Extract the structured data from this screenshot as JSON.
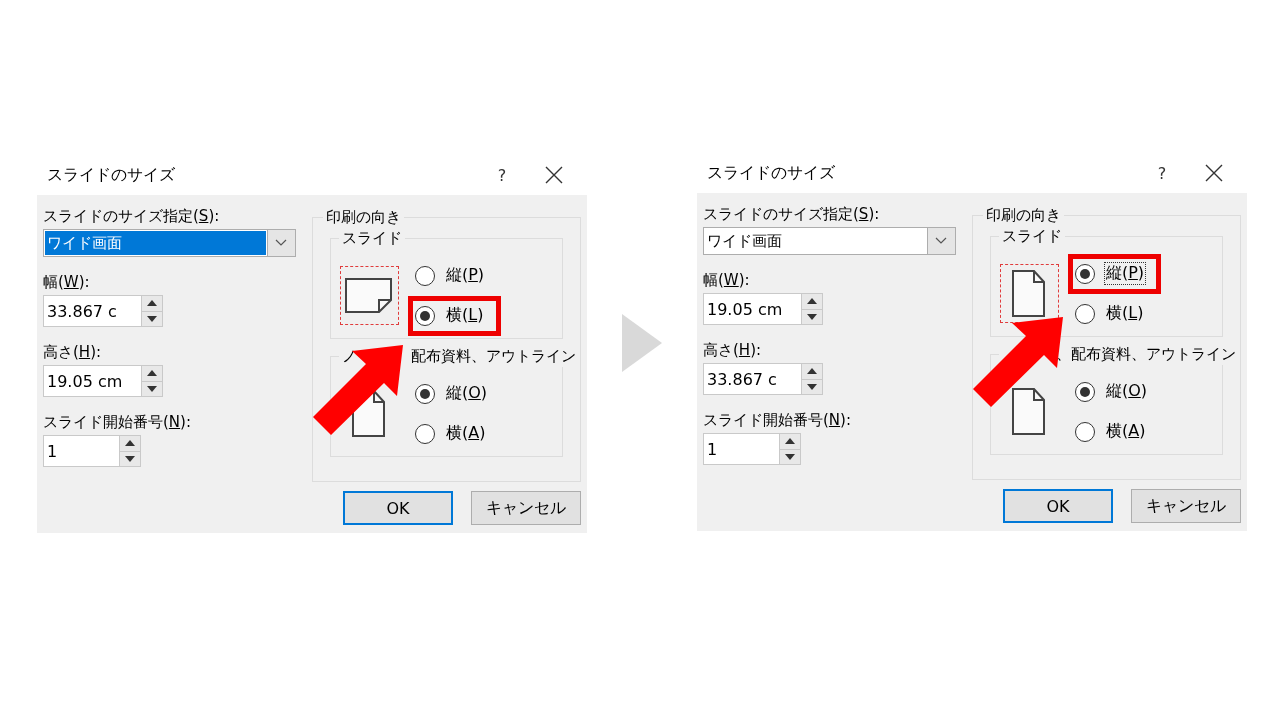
{
  "dialogs": [
    {
      "title": "スライドのサイズ",
      "help": "?",
      "size_label": [
        "スライドのサイズ指定(",
        "S",
        "):"
      ],
      "size_value": "ワイド画面",
      "size_value_highlighted": true,
      "width_label": [
        "幅(",
        "W",
        "):"
      ],
      "width_value": "33.867 c",
      "height_label": [
        "高さ(",
        "H",
        "):"
      ],
      "height_value": "19.05 cm",
      "start_label": [
        "スライド開始番号(",
        "N",
        "):"
      ],
      "start_value": "1",
      "orientation_title": "印刷の向き",
      "slide_group": {
        "label_parts": [
          {
            "kind": "text",
            "text": "スライド"
          }
        ],
        "landscape": true,
        "options": [
          {
            "label": [
              "縦(",
              "P",
              ")"
            ],
            "selected": false,
            "focused": false,
            "highlighted": false
          },
          {
            "label": [
              "横(",
              "L",
              ")"
            ],
            "selected": true,
            "focused": false,
            "highlighted": true
          }
        ]
      },
      "notes_group": {
        "label_parts": [
          {
            "kind": "text",
            "text": "ノ"
          },
          {
            "kind": "covered"
          },
          {
            "kind": "text",
            "text": "配布資料、アウトライン"
          }
        ],
        "landscape": false,
        "options": [
          {
            "label": [
              "縦(",
              "O",
              ")"
            ],
            "selected": true,
            "focused": false,
            "highlighted": false
          },
          {
            "label": [
              "横(",
              "A",
              ")"
            ],
            "selected": false,
            "focused": false,
            "highlighted": false
          }
        ]
      },
      "buttons": [
        {
          "label": "OK",
          "default": true
        },
        {
          "label": "キャンセル",
          "default": false
        }
      ]
    },
    {
      "title": "スライドのサイズ",
      "help": "?",
      "size_label": [
        "スライドのサイズ指定(",
        "S",
        "):"
      ],
      "size_value": "ワイド画面",
      "size_value_highlighted": false,
      "width_label": [
        "幅(",
        "W",
        "):"
      ],
      "width_value": "19.05 cm",
      "height_label": [
        "高さ(",
        "H",
        "):"
      ],
      "height_value": "33.867 c",
      "start_label": [
        "スライド開始番号(",
        "N",
        "):"
      ],
      "start_value": "1",
      "orientation_title": "印刷の向き",
      "slide_group": {
        "label_parts": [
          {
            "kind": "text",
            "text": "スライド"
          }
        ],
        "landscape": false,
        "options": [
          {
            "label": [
              "縦(",
              "P",
              ")"
            ],
            "selected": true,
            "focused": true,
            "highlighted": true
          },
          {
            "label": [
              "横(",
              "L",
              ")"
            ],
            "selected": false,
            "focused": false,
            "highlighted": false
          }
        ]
      },
      "notes_group": {
        "label_parts": [
          {
            "kind": "covered"
          },
          {
            "kind": "text",
            "text": "、配布資料、アウトライン"
          }
        ],
        "landscape": false,
        "options": [
          {
            "label": [
              "縦(",
              "O",
              ")"
            ],
            "selected": true,
            "focused": false,
            "highlighted": false
          },
          {
            "label": [
              "横(",
              "A",
              ")"
            ],
            "selected": false,
            "focused": false,
            "highlighted": false
          }
        ]
      },
      "buttons": [
        {
          "label": "OK",
          "default": true
        },
        {
          "label": "キャンセル",
          "default": false
        }
      ]
    }
  ]
}
